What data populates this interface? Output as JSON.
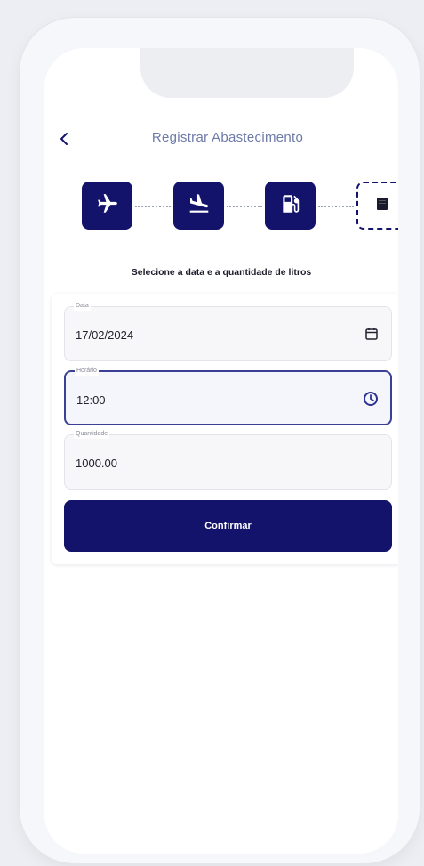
{
  "header": {
    "title": "Registrar Abastecimento",
    "back_icon": "chevron-left-icon"
  },
  "stepper": {
    "steps": [
      {
        "icon": "airplane-icon",
        "state": "completed"
      },
      {
        "icon": "airplane-landing-icon",
        "state": "completed"
      },
      {
        "icon": "fuel-pump-icon",
        "state": "completed"
      },
      {
        "icon": "document-icon",
        "state": "current"
      }
    ]
  },
  "subtitle": "Selecione a data e a quantidade de litros",
  "form": {
    "date": {
      "label": "Data",
      "value": "17/02/2024",
      "icon": "calendar-icon"
    },
    "time": {
      "label": "Horário",
      "value": "12:00",
      "icon": "clock-icon"
    },
    "quantity": {
      "label": "Quantidade",
      "value": "1000.00"
    },
    "confirm_label": "Confirmar"
  },
  "colors": {
    "primary": "#13136b",
    "title": "#6d7aa8",
    "focus_border": "#3c3f96"
  }
}
